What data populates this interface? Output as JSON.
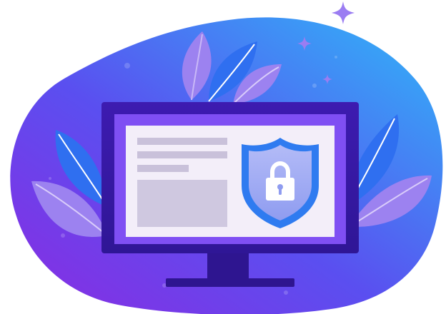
{
  "illustration": {
    "subject": "computer-security",
    "icons": [
      "monitor-icon",
      "shield-icon",
      "padlock-icon",
      "leaf-icon",
      "sparkle-icon"
    ],
    "colors": {
      "blob_start": "#8a2be2",
      "blob_mid": "#5a4ff0",
      "blob_end": "#2fb8f8",
      "monitor_frame": "#3b1aa8",
      "monitor_stand": "#2e1590",
      "screen_border": "#7f4ff3",
      "screen_bg": "#f3eef9",
      "placeholder_lines": "#c9c1da",
      "shield_outer": "#2f7bf0",
      "shield_inner": "#a9b3f5",
      "leaf_blue": "#2f6ff0",
      "leaf_violet": "#9c82f0",
      "sparkle": "#9b7df2"
    }
  }
}
